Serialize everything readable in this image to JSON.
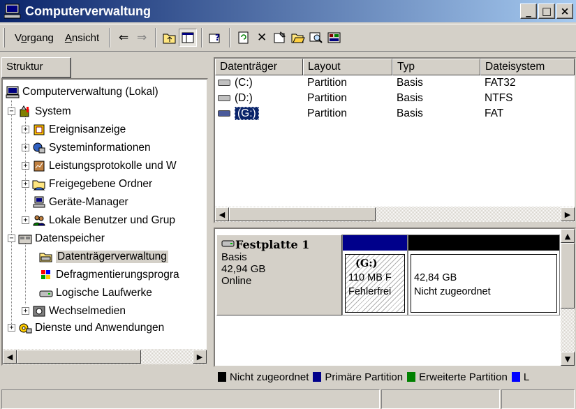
{
  "window": {
    "title": "Computerverwaltung",
    "controls": {
      "minimize": "_",
      "maximize": "□",
      "close": "×"
    }
  },
  "menu": {
    "vorgang": {
      "accel": "o",
      "pre": "V",
      "post": "rgang"
    },
    "ansicht": {
      "accel": "A",
      "pre": "",
      "post": "nsicht"
    }
  },
  "toolbar": {
    "icons": [
      "back-arrow-icon",
      "forward-arrow-icon",
      "up-folder-icon",
      "show-hide-tree-icon",
      "help-icon",
      "refresh-icon",
      "delete-icon",
      "properties-icon",
      "open-icon",
      "search-icon",
      "disk-icon"
    ],
    "glyphs": {
      "back": "⇐",
      "forward": "⇒",
      "delete": "✕"
    }
  },
  "tree": {
    "tab_label": "Struktur",
    "nodes": {
      "root": "Computerverwaltung (Lokal)",
      "system": "System",
      "ereignis": "Ereignisanzeige",
      "sysinfo": "Systeminformationen",
      "leistung": "Leistungsprotokolle und W",
      "freigabe": "Freigegebene Ordner",
      "geraete": "Geräte-Manager",
      "benutzer": "Lokale Benutzer und Grup",
      "datenspeicher": "Datenspeicher",
      "dtv": "Datenträgerverwaltung",
      "defrag": "Defragmentierungsprogra",
      "logische": "Logische Laufwerke",
      "wechsel": "Wechselmedien",
      "dienste": "Dienste und Anwendungen"
    },
    "selected": "Datenträgerverwaltung"
  },
  "volumes": {
    "columns": [
      "Datenträger",
      "Layout",
      "Typ",
      "Dateisystem"
    ],
    "rows": [
      {
        "name": "(C:)",
        "layout": "Partition",
        "type": "Basis",
        "fs": "FAT32"
      },
      {
        "name": "(D:)",
        "layout": "Partition",
        "type": "Basis",
        "fs": "NTFS"
      },
      {
        "name": "(G:)",
        "layout": "Partition",
        "type": "Basis",
        "fs": "FAT"
      }
    ],
    "selected_row": "(G:)"
  },
  "disk": {
    "name": "Festplatte 1",
    "type": "Basis",
    "size": "42,94 GB",
    "status": "Online",
    "partitions": {
      "g": {
        "label": "(G:)",
        "size": "110 MB F",
        "status": "Fehlerfrei",
        "color": "#00008b"
      },
      "unalloc": {
        "size": "42,84 GB",
        "status": "Nicht zugeordnet",
        "color": "#000000"
      }
    }
  },
  "legend": [
    {
      "label": "Nicht zugeordnet",
      "color": "#000000"
    },
    {
      "label": "Primäre Partition",
      "color": "#00008b"
    },
    {
      "label": "Erweiterte Partition",
      "color": "#008000"
    },
    {
      "label": "L",
      "color": "#0000ff"
    }
  ]
}
